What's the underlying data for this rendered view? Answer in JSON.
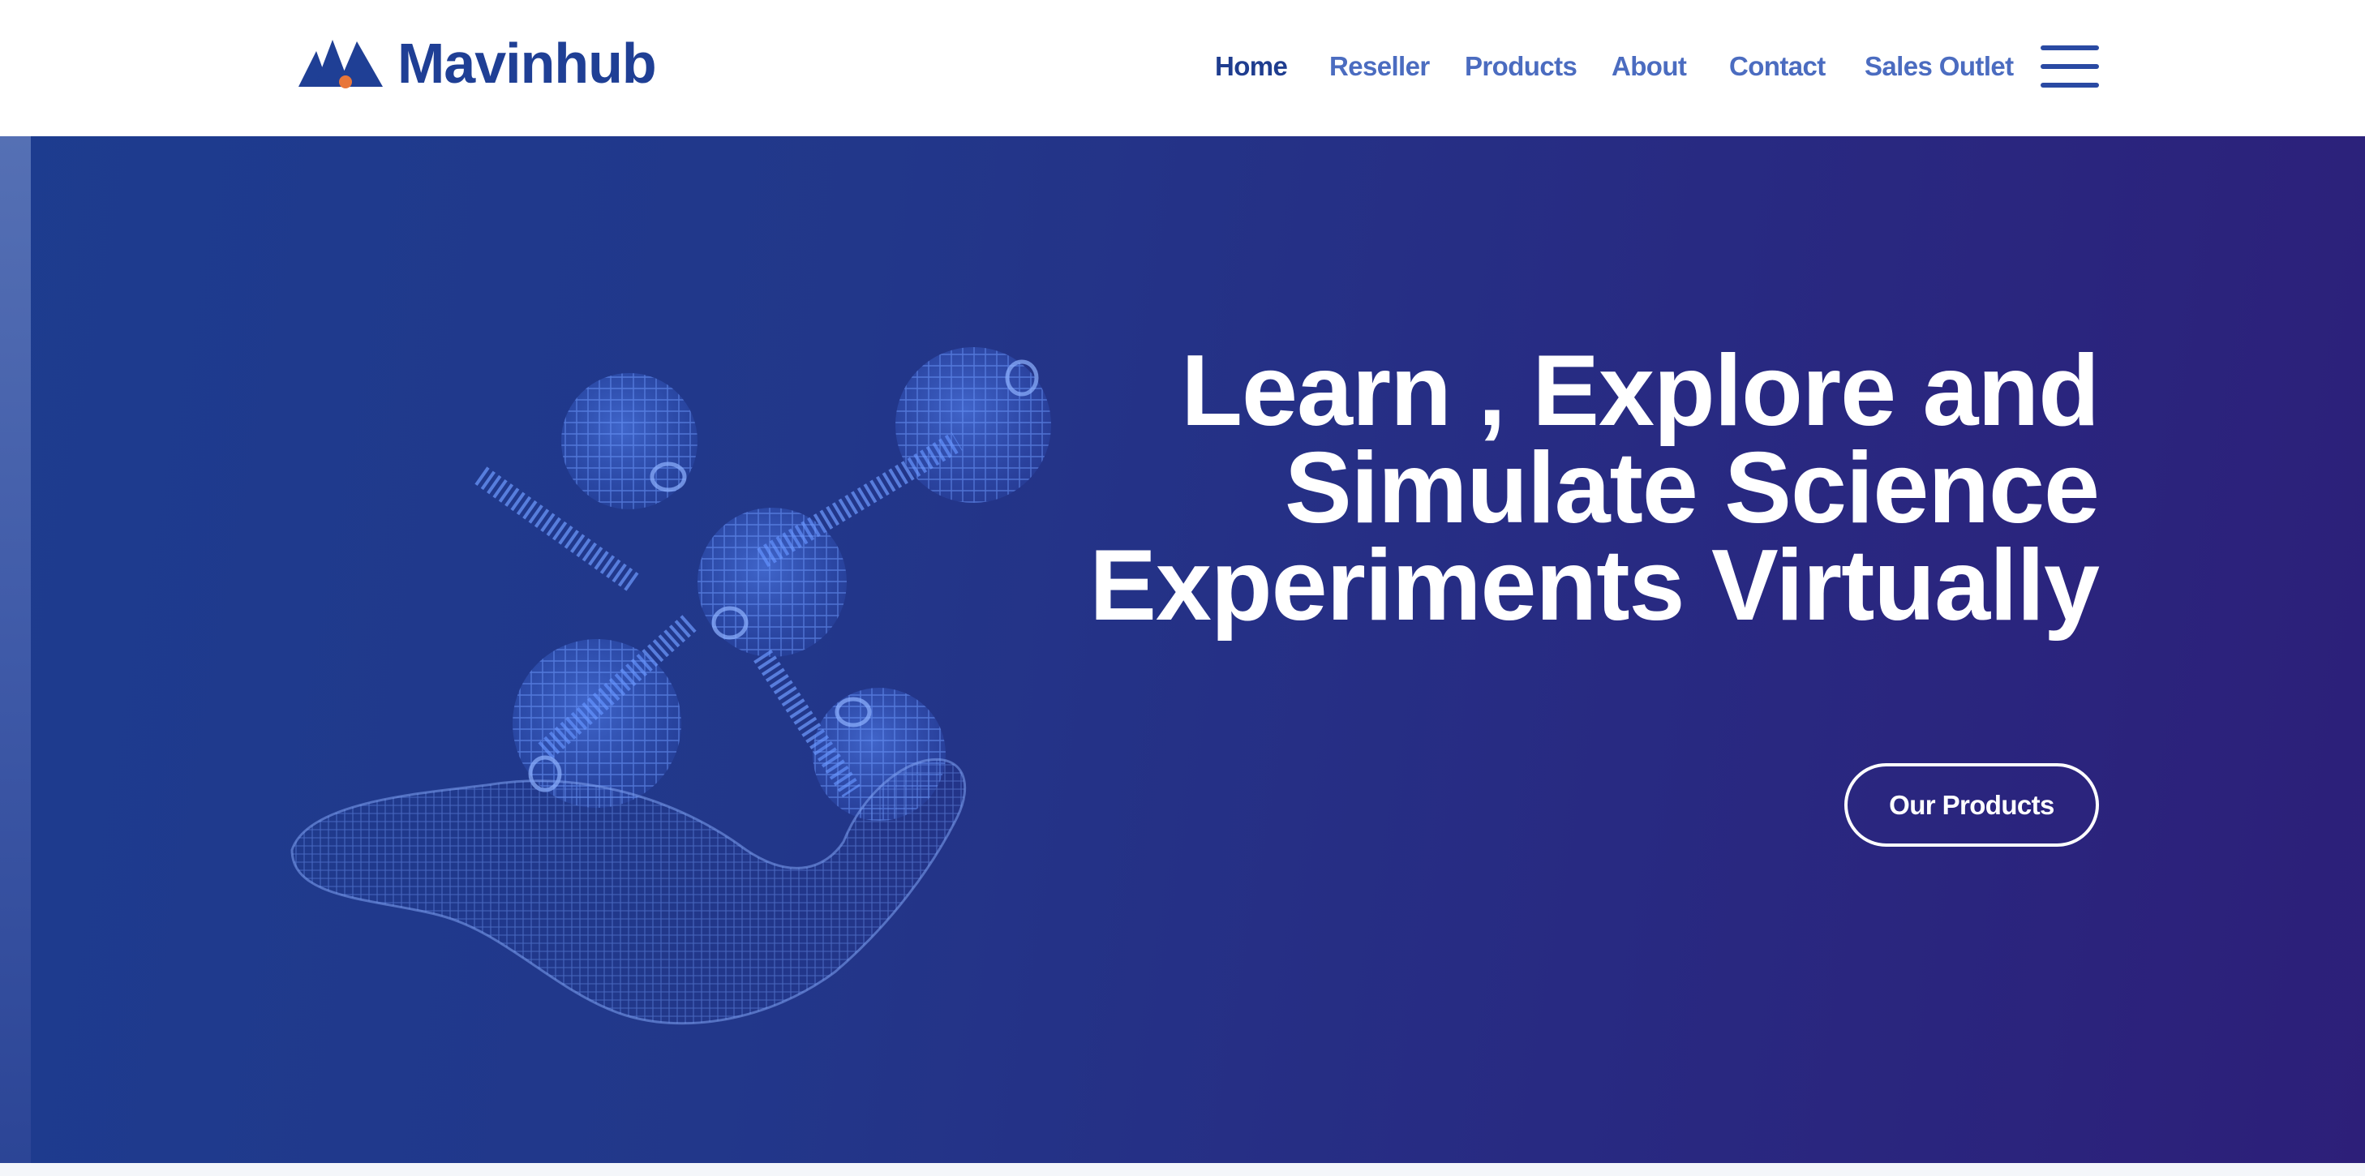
{
  "brand": {
    "name": "Mavinhub",
    "logo_icon": "mountain-peaks-logo-icon",
    "colors": {
      "primary": "#1f3f95",
      "accent": "#e8763a"
    }
  },
  "nav": {
    "links": [
      {
        "label": "Home",
        "active": true
      },
      {
        "label": "Reseller"
      },
      {
        "label": "Products"
      },
      {
        "label": "About"
      },
      {
        "label": "Contact"
      },
      {
        "label": "Sales Outlet"
      }
    ],
    "menu_icon": "hamburger-menu-icon",
    "colors": {
      "link": "#4b6cc0",
      "active": "#1f3d8f"
    }
  },
  "hero": {
    "title_lines": [
      "Learn , Explore and",
      "Simulate Science",
      "Experiments Virtually"
    ],
    "cta_label": "Our Products",
    "illustration": "wireframe-hand-holding-molecule",
    "colors": {
      "bg_start": "#1d3c8f",
      "bg_end": "#2d1f79",
      "wireframe": "#4f7ff0"
    }
  }
}
